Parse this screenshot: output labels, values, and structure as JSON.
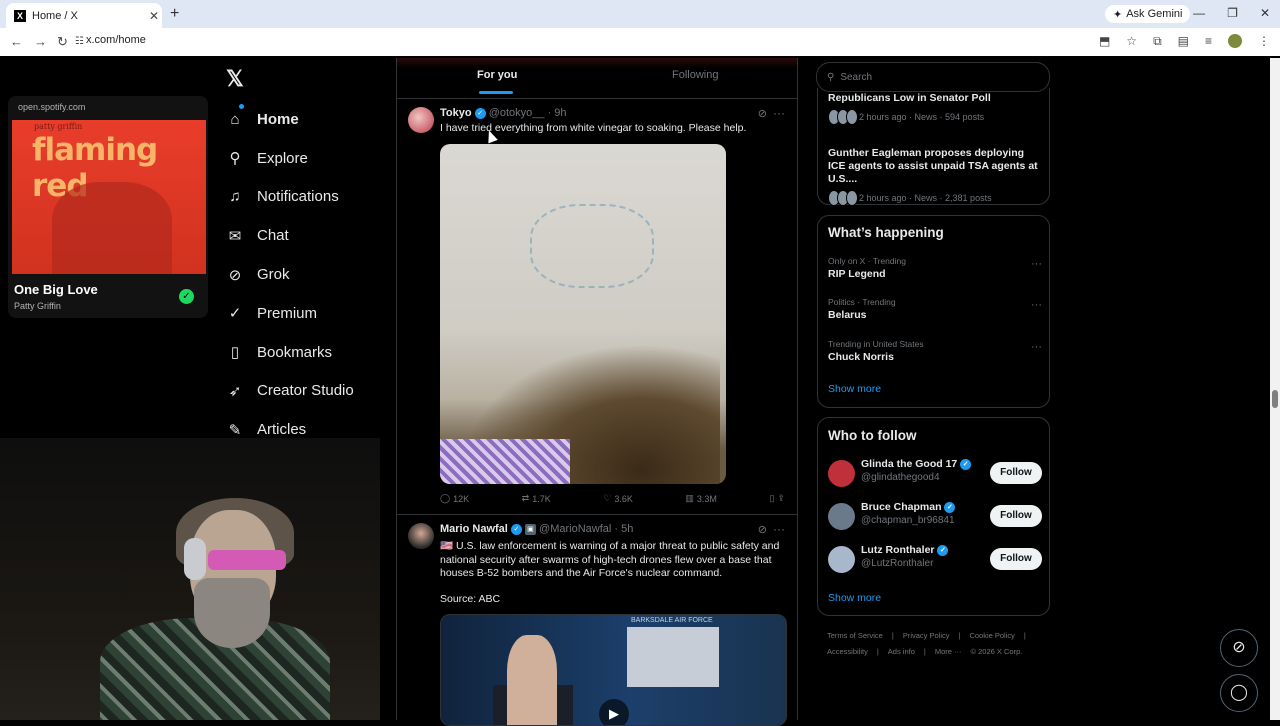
{
  "browser": {
    "tab_title": "Home / X",
    "tab_favicon": "X",
    "tab_close": "✕",
    "new_tab": "+",
    "gemini_label": "Ask Gemini",
    "url": "x.com/home",
    "window_buttons": [
      "—",
      "❐",
      "✕"
    ]
  },
  "spotify": {
    "source": "open.spotify.com",
    "album_artist_small": "patty griffin",
    "album_title_art": "flaming red",
    "song": "One Big Love",
    "artist": "Patty Griffin"
  },
  "nav": {
    "logo": "𝕏",
    "items": [
      {
        "label": "Home",
        "icon": "home-icon"
      },
      {
        "label": "Explore",
        "icon": "search-icon"
      },
      {
        "label": "Notifications",
        "icon": "bell-icon"
      },
      {
        "label": "Chat",
        "icon": "mail-icon"
      },
      {
        "label": "Grok",
        "icon": "grok-icon"
      },
      {
        "label": "Premium",
        "icon": "premium-icon"
      },
      {
        "label": "Bookmarks",
        "icon": "bookmark-icon"
      },
      {
        "label": "Creator Studio",
        "icon": "rocket-icon"
      },
      {
        "label": "Articles",
        "icon": "articles-icon"
      }
    ]
  },
  "feed": {
    "tabs": [
      "For you",
      "Following"
    ],
    "posts": [
      {
        "name": "Tokyo",
        "handle": "@otokyo__",
        "time": "· 9h",
        "text": "I have tried everything from white vinegar to soaking. Please help.",
        "replies": "12K",
        "reposts": "1.7K",
        "likes": "3.6K",
        "views": "3.3M"
      },
      {
        "name": "Mario Nawfal",
        "handle": "@MarioNawfal · 5h",
        "text": "🇺🇸 U.S. law enforcement is warning of a major threat to public safety and national security after swarms of high-tech drones flew over a base that houses B-52 bombers and the Air Force's nuclear command.",
        "source": "Source: ABC",
        "media_label": "BARKSDALE AIR FORCE"
      }
    ]
  },
  "right": {
    "search_placeholder": "Search",
    "news": [
      {
        "headline": "Republicans Low in Senator Poll",
        "meta": "2 hours ago · News · 594 posts"
      },
      {
        "headline": "Gunther Eagleman proposes deploying ICE agents to assist unpaid TSA agents at U.S....",
        "meta": "2 hours ago · News · 2,381 posts"
      }
    ],
    "happening_title": "What’s happening",
    "trends": [
      {
        "context": "Only on X · Trending",
        "title": "RIP Legend"
      },
      {
        "context": "Politics · Trending",
        "title": "Belarus"
      },
      {
        "context": "Trending in United States",
        "title": "Chuck Norris"
      }
    ],
    "show_more": "Show more",
    "who_title": "Who to follow",
    "follow": [
      {
        "name": "Glinda the Good 17",
        "handle": "@glindathegood4",
        "color": "#c0303b"
      },
      {
        "name": "Bruce Chapman",
        "handle": "@chapman_br96841",
        "color": "#6b7a8b"
      },
      {
        "name": "Lutz Ronthaler",
        "handle": "@LutzRonthaler",
        "color": "#a8b7c9"
      }
    ],
    "follow_label": "Follow",
    "footer": [
      "Terms of Service",
      "|",
      "Privacy Policy",
      "|",
      "Cookie Policy",
      "|",
      "Accessibility",
      "|",
      "Ads info",
      "|",
      "More ···",
      "© 2026 X Corp."
    ]
  },
  "colors": {
    "accent": "#1d9bf0",
    "background": "#000000",
    "spotify_green": "#1ed760"
  }
}
